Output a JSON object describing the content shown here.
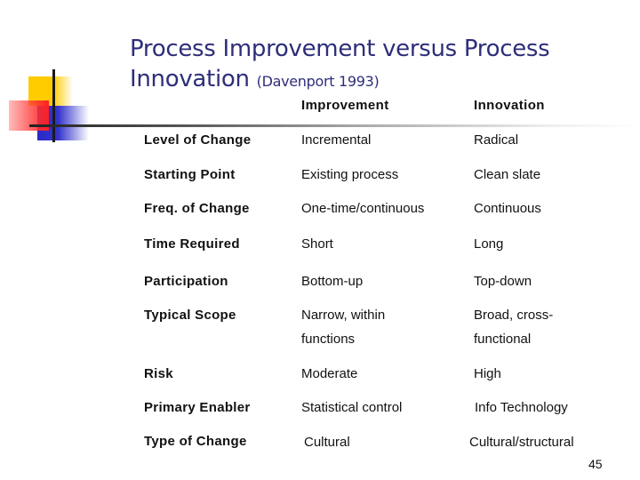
{
  "slide": {
    "title_main_line1": "Process Improvement versus Process",
    "title_main_line2": "Innovation",
    "title_citation": "(Davenport 1993)",
    "page_number": "45"
  },
  "table": {
    "columns": [
      "",
      "Improvement",
      "Innovation"
    ],
    "rows": [
      {
        "label": "Level of Change",
        "improvement": "Incremental",
        "innovation": "Radical"
      },
      {
        "label": "Starting Point",
        "improvement": "Existing process",
        "innovation": "Clean slate"
      },
      {
        "label": "Freq. of Change",
        "improvement": "One-time/continuous",
        "innovation": "Continuous"
      },
      {
        "label": "Time Required",
        "improvement": "Short",
        "innovation": "Long"
      },
      {
        "label": "Participation",
        "improvement": "Bottom-up",
        "innovation": "Top-down"
      },
      {
        "label": "Typical Scope",
        "improvement": "Narrow, within",
        "improvement_cont": "functions",
        "innovation": "Broad, cross-",
        "innovation_cont": "functional"
      },
      {
        "label": "Risk",
        "improvement": "Moderate",
        "innovation": "High"
      },
      {
        "label": "Primary Enabler",
        "improvement": "Statistical control",
        "innovation": "Info Technology"
      },
      {
        "label": "Type of Change",
        "improvement": "Cultural",
        "innovation": "Cultural/structural"
      }
    ]
  },
  "colors": {
    "title": "#2e2e7a",
    "logo_yellow": "#ffcc00",
    "logo_red": "#ff2020",
    "logo_blue": "#3333cc"
  }
}
